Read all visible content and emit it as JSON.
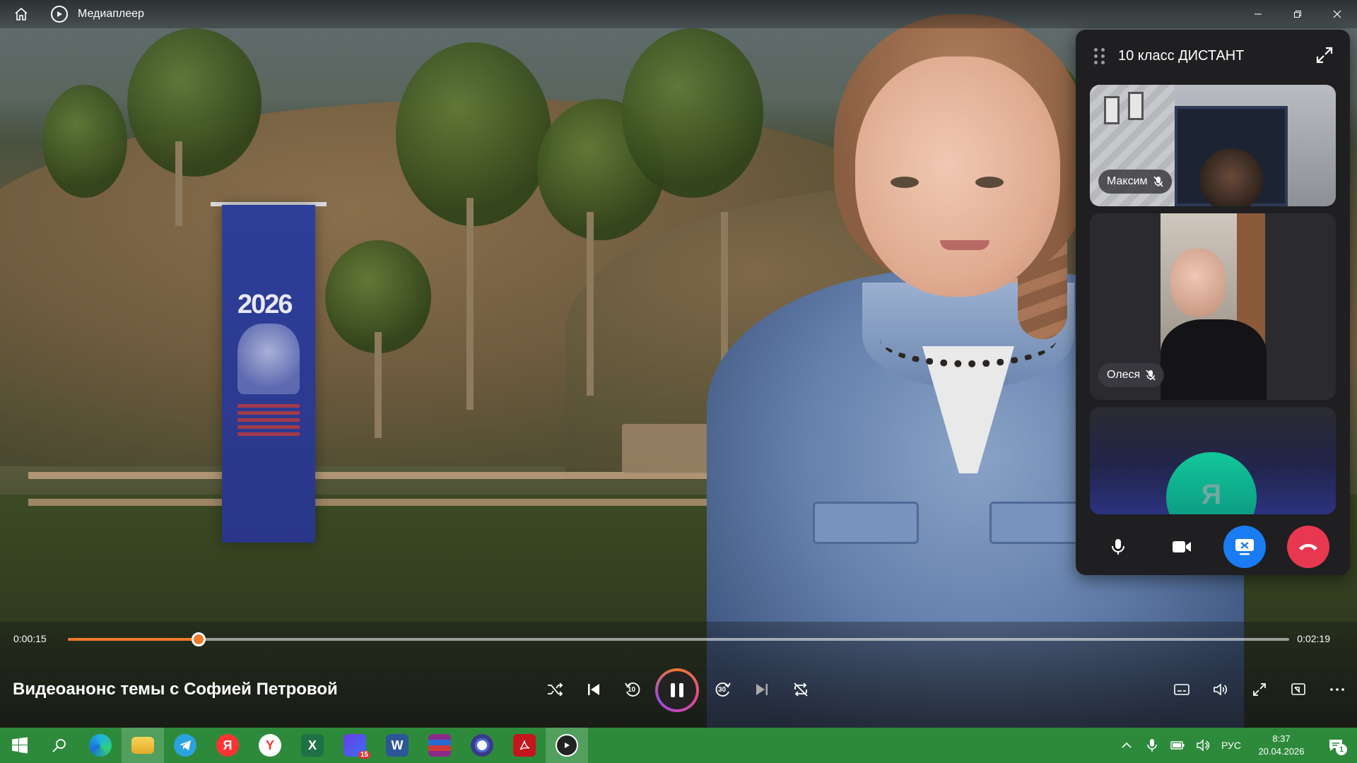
{
  "titlebar": {
    "app_title": "Медиаплеер"
  },
  "call": {
    "title": "10 класс ДИСТАНТ",
    "participants": [
      {
        "name": "Максим",
        "muted": true
      },
      {
        "name": "Олеся",
        "muted": true
      },
      {
        "name": "",
        "avatar_letter": "Я",
        "avatar_color": "#12c79a"
      }
    ],
    "share_color": "#1a7cf2",
    "end_color": "#e8384f"
  },
  "player": {
    "time_current": "0:00:15",
    "time_total": "0:02:19",
    "progress_fraction": 0.107,
    "video_title": "Видеоанонс темы с Софией Петровой",
    "accent_color": "#f07a2a",
    "skip_back": "10",
    "skip_forward": "30"
  },
  "video_scene": {
    "banner_text": "2026"
  },
  "taskbar": {
    "background": "#2d8a3b",
    "apps": [
      {
        "icon": "edge-icon"
      },
      {
        "icon": "file-explorer-icon",
        "active": true
      },
      {
        "icon": "telegram-icon"
      },
      {
        "icon": "yandex-icon",
        "letter": "Я"
      },
      {
        "icon": "yandex-browser-icon",
        "letter": "Y"
      },
      {
        "icon": "excel-icon",
        "letter": "X"
      },
      {
        "icon": "calendar-app-icon",
        "badge": "15"
      },
      {
        "icon": "word-icon",
        "letter": "W"
      },
      {
        "icon": "winrar-icon"
      },
      {
        "icon": "chrome-like-icon"
      },
      {
        "icon": "acrobat-icon"
      },
      {
        "icon": "media-player-icon",
        "active": true
      }
    ],
    "language": "РУС",
    "time": "8:37",
    "date": "20.04.2026",
    "notifications": "1"
  }
}
